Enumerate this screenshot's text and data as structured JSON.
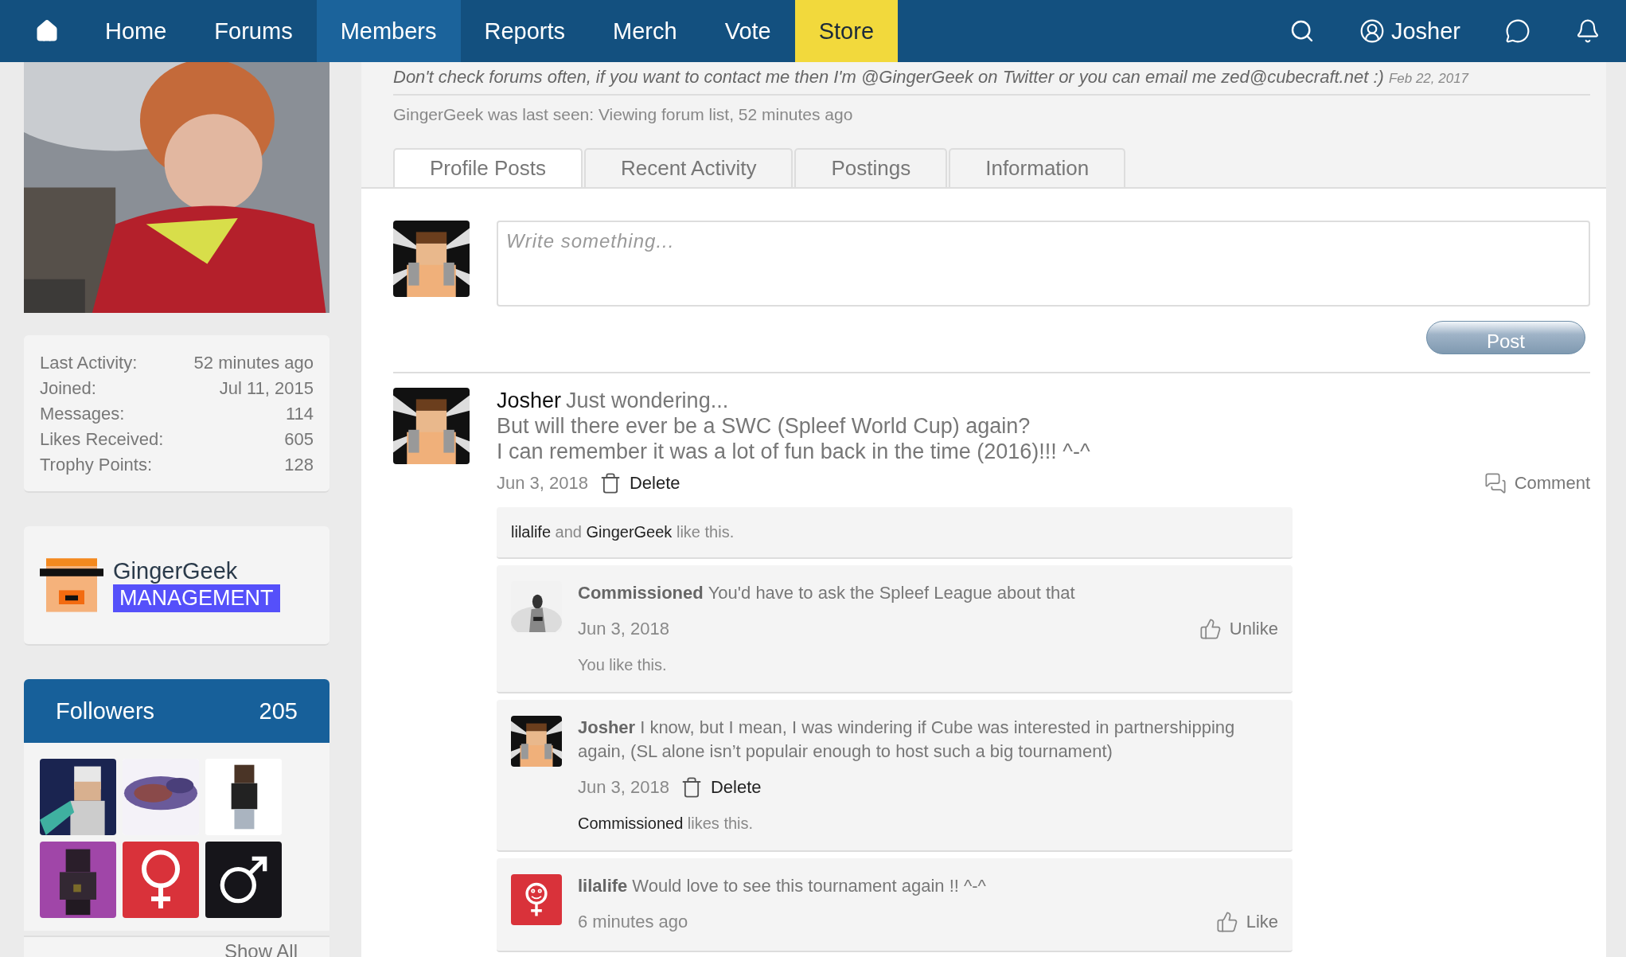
{
  "nav": {
    "items": [
      {
        "label": "Home",
        "selected": false,
        "kind": "link"
      },
      {
        "label": "Forums",
        "selected": false,
        "kind": "link"
      },
      {
        "label": "Members",
        "selected": true,
        "kind": "link"
      },
      {
        "label": "Reports",
        "selected": false,
        "kind": "link"
      },
      {
        "label": "Merch",
        "selected": false,
        "kind": "link"
      },
      {
        "label": "Vote",
        "selected": false,
        "kind": "link"
      },
      {
        "label": "Store",
        "selected": false,
        "kind": "promo"
      }
    ],
    "user": "Josher"
  },
  "profile": {
    "status": "Don't check forums often, if you want to contact me then I'm @GingerGeek on Twitter or you can email me zed@cubecraft.net :)",
    "status_date": "Feb 22, 2017",
    "last_seen": "GingerGeek was last seen: Viewing forum list, 52 minutes ago"
  },
  "stats": [
    {
      "label": "Last Activity:",
      "value": "52 minutes ago"
    },
    {
      "label": "Joined:",
      "value": "Jul 11, 2015"
    },
    {
      "label": "Messages:",
      "value": "114"
    },
    {
      "label": "Likes Received:",
      "value": "605"
    },
    {
      "label": "Trophy Points:",
      "value": "128"
    }
  ],
  "member": {
    "name": "GingerGeek",
    "rank": "MANAGEMENT"
  },
  "followers": {
    "title": "Followers",
    "count": "205",
    "show_all": "Show All",
    "items": [
      {
        "kind": "picture"
      },
      {
        "kind": "picture"
      },
      {
        "kind": "picture"
      },
      {
        "kind": "picture"
      },
      {
        "kind": "female"
      },
      {
        "kind": "male"
      }
    ]
  },
  "tabs": [
    {
      "label": "Profile Posts",
      "selected": true
    },
    {
      "label": "Recent Activity",
      "selected": false
    },
    {
      "label": "Postings",
      "selected": false
    },
    {
      "label": "Information",
      "selected": false
    }
  ],
  "composer": {
    "placeholder": "Write something...",
    "button": "Post"
  },
  "post": {
    "author": "Josher",
    "lines": [
      "Just wondering...",
      "But will there ever be a SWC (Spleef World Cup) again?",
      "I can remember it was a lot of fun back in the time (2016)!!! ^-^"
    ],
    "date": "Jun 3, 2018",
    "delete": "Delete",
    "comment": "Comment",
    "likes": [
      {
        "text": "lilalife",
        "kind": "user"
      },
      {
        "text": "and",
        "kind": "plain"
      },
      {
        "text": "GingerGeek",
        "kind": "user"
      },
      {
        "text": "like this.",
        "kind": "plain"
      }
    ],
    "comments": [
      {
        "avatar": {
          "kind": "picture"
        },
        "author": "Commissioned",
        "text": "You'd have to ask the Spleef League about that",
        "date": "Jun 3, 2018",
        "action": {
          "kind": "like",
          "label": "Unlike"
        },
        "likes": [
          {
            "text": "You like this.",
            "kind": "plain"
          }
        ]
      },
      {
        "avatar": {
          "kind": "picture"
        },
        "author": "Josher",
        "text": "I know, but I mean, I was windering if Cube was interested in partnershipping again, (SL alone isn’t populair enough to host such a big tournament)",
        "date": "Jun 3, 2018",
        "action": {
          "kind": "delete",
          "label": "Delete"
        },
        "likes": [
          {
            "text": "Commissioned",
            "kind": "user"
          },
          {
            "text": "likes this.",
            "kind": "plain"
          }
        ]
      },
      {
        "avatar": {
          "kind": "female"
        },
        "author": "lilalife",
        "text": "Would love to see this tournament again !! ^-^",
        "date": "6 minutes ago",
        "action": {
          "kind": "like",
          "label": "Like"
        }
      }
    ]
  }
}
